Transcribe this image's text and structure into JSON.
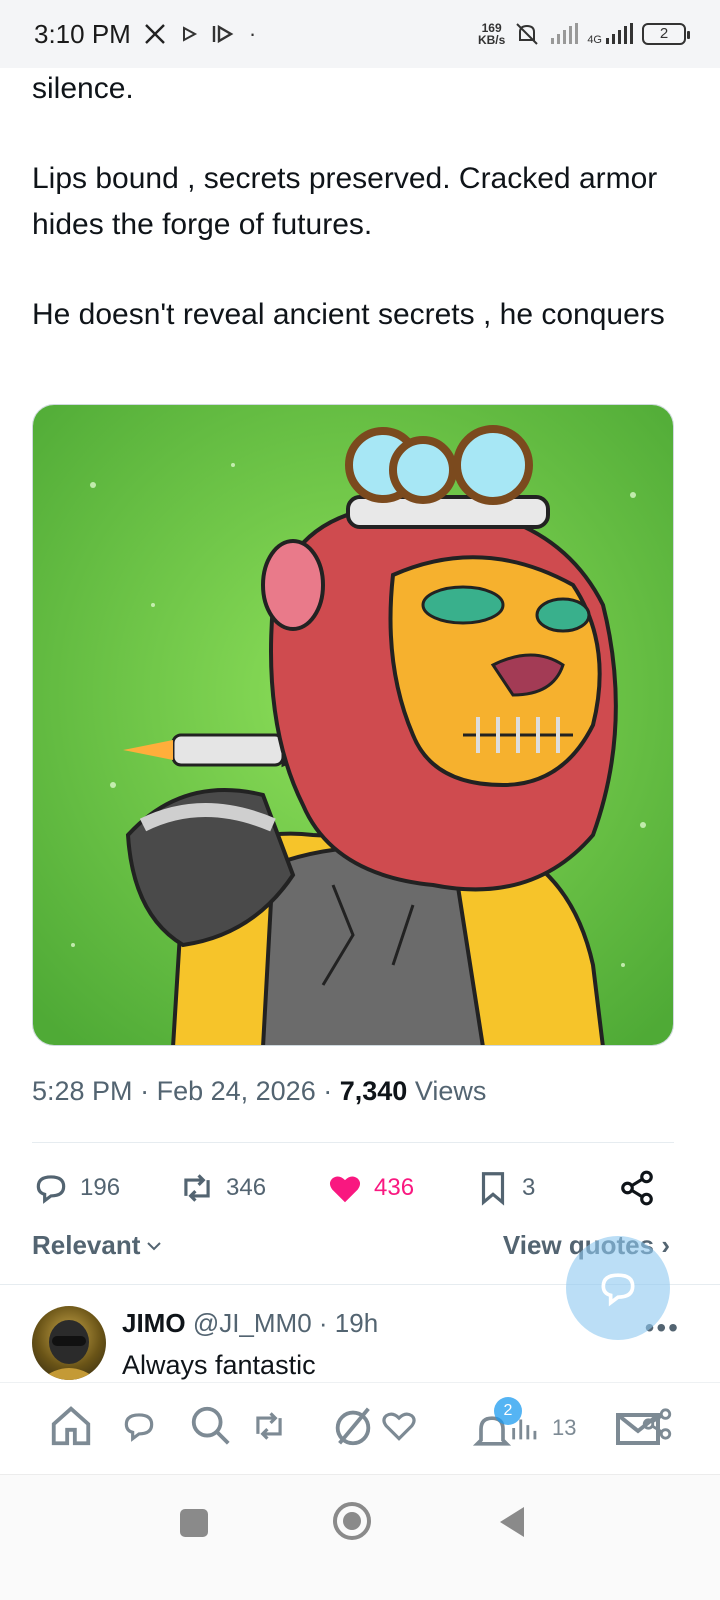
{
  "status_bar": {
    "time": "3:10 PM",
    "speed_value": "169",
    "speed_unit": "KB/s",
    "network": "4G",
    "battery": "2"
  },
  "tweet": {
    "text_line0": "silence.",
    "text_line1": "Lips bound , secrets preserved. Cracked armor hides the forge of futures.",
    "text_line2": "He doesn't reveal ancient secrets , he conquers",
    "time": "5:28 PM",
    "date": "Feb 24, 2026",
    "views_count": "7,340",
    "views_label": "Views"
  },
  "actions": {
    "replies": "196",
    "reposts": "346",
    "likes": "436",
    "bookmarks": "3"
  },
  "reply_sort": {
    "label": "Relevant",
    "view_quotes": "View quotes"
  },
  "reply": {
    "name": "JIMO",
    "handle": "@JI_MM0",
    "age": "19h",
    "text": "Always fantastic",
    "more": "•••"
  },
  "bottom_nav": {
    "notifications_badge": "2",
    "analytics_count": "13"
  },
  "colors": {
    "accent": "#1d9bf0",
    "like": "#f91880",
    "muted": "#536471",
    "image_bg": "#6cc544"
  }
}
